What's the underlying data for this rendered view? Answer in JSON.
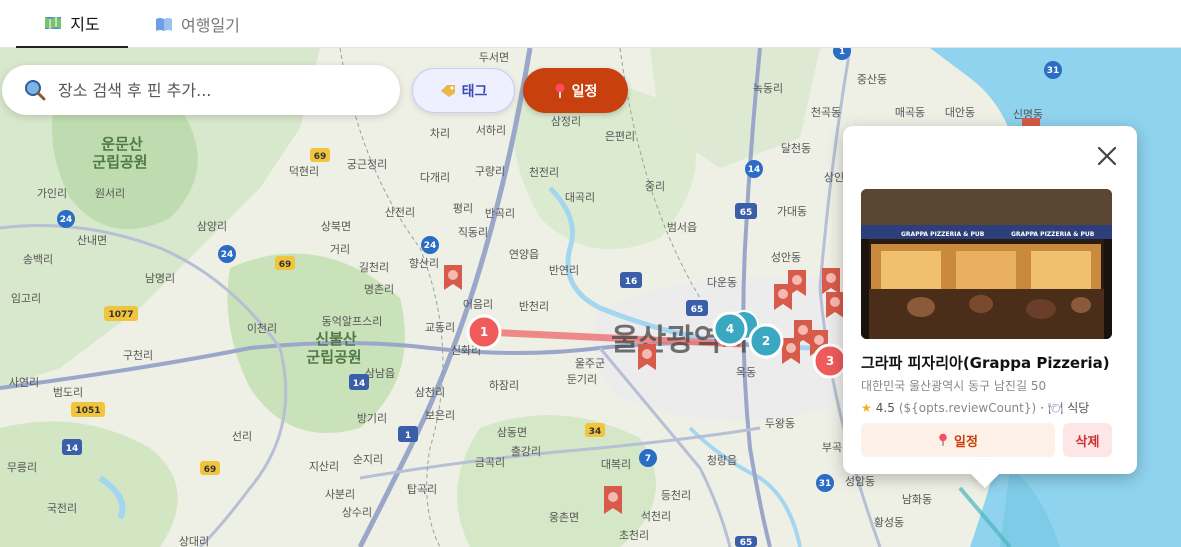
{
  "tabs": [
    {
      "label": "지도",
      "icon": "map-icon",
      "active": true
    },
    {
      "label": "여행일기",
      "icon": "book-icon",
      "active": false
    }
  ],
  "search": {
    "placeholder": "장소 검색 후 핀 추가..."
  },
  "toolbar": {
    "tag_label": "태그",
    "plan_label": "일정"
  },
  "map": {
    "area_labels": {
      "forest1": "운문산",
      "forest1b": "군립공원",
      "forest2": "신불산",
      "forest2b": "군립공원",
      "city": "울산광역시"
    },
    "place_labels": [
      "두서면",
      "녹동리",
      "중산동",
      "차리",
      "서하리",
      "삼정리",
      "은편리",
      "매곡동",
      "대안동",
      "신명동",
      "궁근정리",
      "다개리",
      "구량리",
      "천전리",
      "중리",
      "천곡동",
      "가인리",
      "원서리",
      "덕현리",
      "대곡리",
      "달천동",
      "산전리",
      "평리",
      "반곡리",
      "범서읍",
      "가대동",
      "상인",
      "삼양리",
      "상북면",
      "거리",
      "직동리",
      "연양읍",
      "다운동",
      "송백리",
      "산내면",
      "남명리",
      "길천리",
      "향산리",
      "반연리",
      "성안동",
      "임고리",
      "명촌리",
      "어음리",
      "반천리",
      "동억알프스리",
      "교동리",
      "울주군",
      "이천리",
      "구천리",
      "신화리",
      "둔기리",
      "삼남읍",
      "사연리",
      "범도리",
      "하잠리",
      "옥동",
      "방기리",
      "삼천리",
      "보은리",
      "선리",
      "두왕동",
      "삼동면",
      "무릉리",
      "지산리",
      "순지리",
      "출강리",
      "금곡리",
      "대복리",
      "청량읍",
      "부곡",
      "초천리",
      "탑곡리",
      "등천리",
      "성암동",
      "국전리",
      "상수리",
      "웅촌면",
      "석천리",
      "남화동",
      "사분리",
      "황성동",
      "상대리"
    ],
    "route_numbers": [
      "31",
      "69",
      "24",
      "24",
      "24",
      "69",
      "16",
      "65",
      "65",
      "14",
      "1077",
      "14",
      "1",
      "1051",
      "14",
      "34",
      "7",
      "69",
      "31",
      "65",
      "1"
    ],
    "markers": [
      {
        "label": "1",
        "color": "#ef5b5b"
      },
      {
        "label": "2",
        "color": "#3aa8c1"
      },
      {
        "label": "3",
        "color": "#ef5b5b"
      },
      {
        "label": "4",
        "color": "#3aa8c1"
      }
    ]
  },
  "popup": {
    "name": "그라파 피자리아(Grappa Pizzeria)",
    "address": "대한민국 울산광역시 동구 남진길 50",
    "rating": "4.5",
    "review_count": "(${opts.reviewCount})",
    "separator": "·",
    "category": "식당",
    "add_label": "일정",
    "delete_label": "삭제",
    "photo_sign": "GRAPPA PIZZERIA & PUB",
    "colors": {
      "accent": "#c9400f",
      "danger": "#d0312d"
    }
  }
}
